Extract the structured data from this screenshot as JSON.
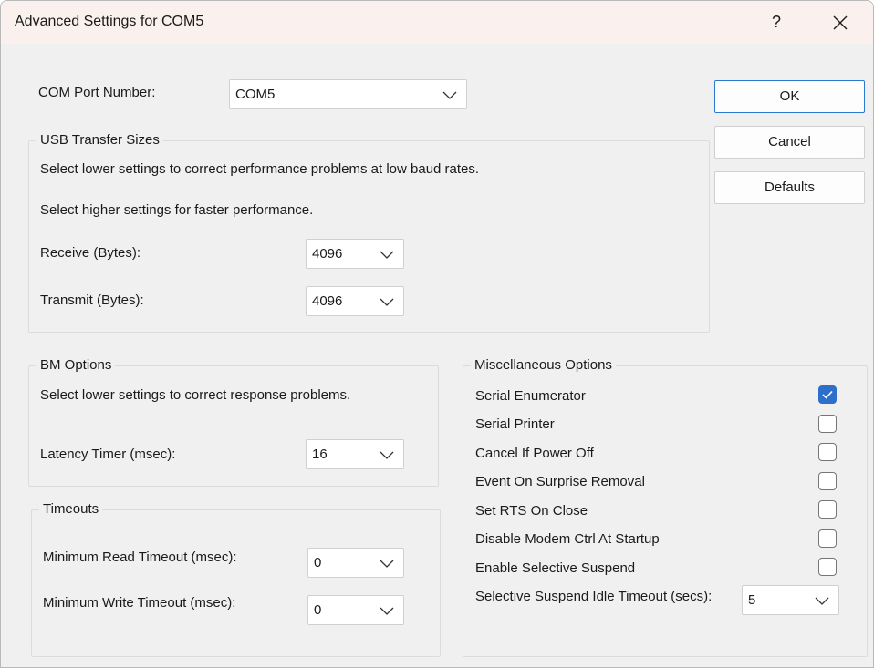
{
  "window": {
    "title": "Advanced Settings for COM5",
    "help_label": "?",
    "close_label": "✕"
  },
  "com_port": {
    "label": "COM Port Number:",
    "value": "COM5"
  },
  "buttons": {
    "ok": "OK",
    "cancel": "Cancel",
    "defaults": "Defaults"
  },
  "usb": {
    "legend": "USB Transfer Sizes",
    "line1": "Select lower settings to correct performance problems at low baud rates.",
    "line2": "Select higher settings for faster performance.",
    "receive_label": "Receive (Bytes):",
    "receive_value": "4096",
    "transmit_label": "Transmit (Bytes):",
    "transmit_value": "4096"
  },
  "bm": {
    "legend": "BM Options",
    "line1": "Select lower settings to correct response problems.",
    "latency_label": "Latency Timer (msec):",
    "latency_value": "16"
  },
  "timeouts": {
    "legend": "Timeouts",
    "read_label": "Minimum Read Timeout (msec):",
    "read_value": "0",
    "write_label": "Minimum Write Timeout (msec):",
    "write_value": "0"
  },
  "misc": {
    "legend": "Miscellaneous Options",
    "options": [
      {
        "label": "Serial Enumerator",
        "checked": true
      },
      {
        "label": "Serial Printer",
        "checked": false
      },
      {
        "label": "Cancel If Power Off",
        "checked": false
      },
      {
        "label": "Event On Surprise Removal",
        "checked": false
      },
      {
        "label": "Set RTS On Close",
        "checked": false
      },
      {
        "label": "Disable Modem Ctrl At Startup",
        "checked": false
      },
      {
        "label": "Enable Selective Suspend",
        "checked": false
      }
    ],
    "idle_label": "Selective Suspend Idle Timeout (secs):",
    "idle_value": "5"
  },
  "icons": {
    "dropdown": "chevron-down-icon",
    "check": "checkmark-icon"
  },
  "colors": {
    "accent": "#2d6fca",
    "titlebar": "#faf0ee",
    "background": "#f0f0f0"
  }
}
